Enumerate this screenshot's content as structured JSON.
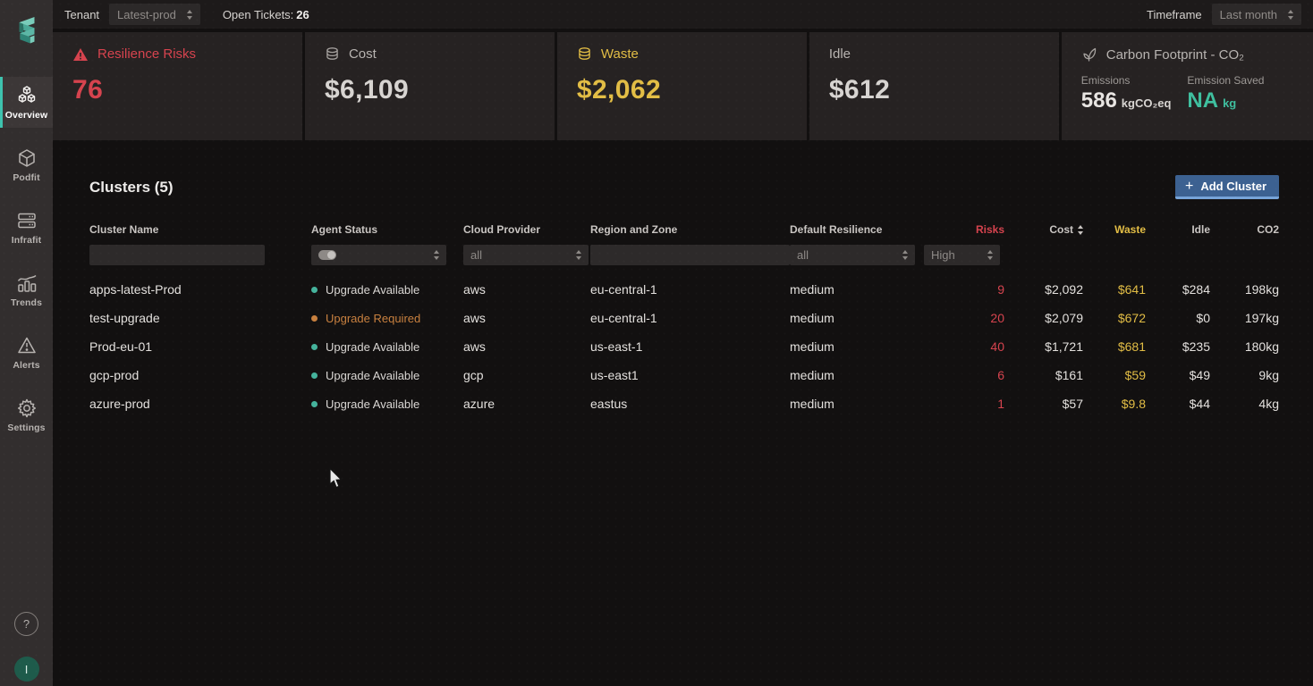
{
  "topbar": {
    "tenant_label": "Tenant",
    "tenant_value": "Latest-prod",
    "open_tickets_label": "Open Tickets:",
    "open_tickets_count": "26",
    "timeframe_label": "Timeframe",
    "timeframe_value": "Last month"
  },
  "sidebar": {
    "items": [
      {
        "label": "Overview",
        "icon": "cubes-icon",
        "active": true
      },
      {
        "label": "Podfit",
        "icon": "cube-icon",
        "active": false
      },
      {
        "label": "Infrafit",
        "icon": "servers-icon",
        "active": false
      },
      {
        "label": "Trends",
        "icon": "bar-chart-icon",
        "active": false
      },
      {
        "label": "Alerts",
        "icon": "warning-triangle-icon",
        "active": false
      },
      {
        "label": "Settings",
        "icon": "gear-icon",
        "active": false
      }
    ],
    "help_label": "?",
    "avatar_label": "I"
  },
  "cards": {
    "resilience": {
      "title": "Resilience Risks",
      "value": "76",
      "icon": "warning-triangle-icon",
      "color": "#d6434e"
    },
    "cost": {
      "title": "Cost",
      "value": "$6,109",
      "icon": "coins-icon"
    },
    "waste": {
      "title": "Waste",
      "value": "$2,062",
      "icon": "coins-icon",
      "color": "#e2bd45"
    },
    "idle": {
      "title": "Idle",
      "value": "$612"
    },
    "carbon": {
      "title": "Carbon Footprint - CO₂",
      "icon": "leaf-icon",
      "emissions_label": "Emissions",
      "emissions_value": "586",
      "emissions_unit": "kgCO₂eq",
      "saved_label": "Emission Saved",
      "saved_value": "NA",
      "saved_unit": "kg",
      "saved_color": "#3fbf9f"
    }
  },
  "clusters": {
    "heading": "Clusters (5)",
    "add_button_plus": "+",
    "add_button_label": "Add Cluster",
    "columns": {
      "name": "Cluster Name",
      "agent": "Agent Status",
      "provider": "Cloud Provider",
      "region": "Region and Zone",
      "resilience": "Default Resilience",
      "risks": "Risks",
      "cost": "Cost",
      "waste": "Waste",
      "idle": "Idle",
      "co2": "CO2"
    },
    "filters": {
      "cluster_name_value": "",
      "provider_value": "all",
      "region_value": "",
      "resilience_value": "all",
      "risks_value": "High"
    },
    "rows": [
      {
        "name": "apps-latest-Prod",
        "status": "Upgrade Available",
        "status_type": "available",
        "provider": "aws",
        "region": "eu-central-1",
        "resilience": "medium",
        "risks": "9",
        "cost": "$2,092",
        "waste": "$641",
        "idle": "$284",
        "co2": "198kg"
      },
      {
        "name": "test-upgrade",
        "status": "Upgrade Required",
        "status_type": "required",
        "provider": "aws",
        "region": "eu-central-1",
        "resilience": "medium",
        "risks": "20",
        "cost": "$2,079",
        "waste": "$672",
        "idle": "$0",
        "co2": "197kg"
      },
      {
        "name": "Prod-eu-01",
        "status": "Upgrade Available",
        "status_type": "available",
        "provider": "aws",
        "region": "us-east-1",
        "resilience": "medium",
        "risks": "40",
        "cost": "$1,721",
        "waste": "$681",
        "idle": "$235",
        "co2": "180kg"
      },
      {
        "name": "gcp-prod",
        "status": "Upgrade Available",
        "status_type": "available",
        "provider": "gcp",
        "region": "us-east1",
        "resilience": "medium",
        "risks": "6",
        "cost": "$161",
        "waste": "$59",
        "idle": "$49",
        "co2": "9kg"
      },
      {
        "name": "azure-prod",
        "status": "Upgrade Available",
        "status_type": "available",
        "provider": "azure",
        "region": "eastus",
        "resilience": "medium",
        "risks": "1",
        "cost": "$57",
        "waste": "$9.8",
        "idle": "$44",
        "co2": "4kg"
      }
    ]
  },
  "colors": {
    "risk_red": "#d6434e",
    "waste_yellow": "#e2bd45",
    "teal_accent": "#3ec3ae",
    "status_available_teal": "#45b39c",
    "status_required_orange": "#c8803f",
    "add_button_blue": "#3c6191"
  }
}
